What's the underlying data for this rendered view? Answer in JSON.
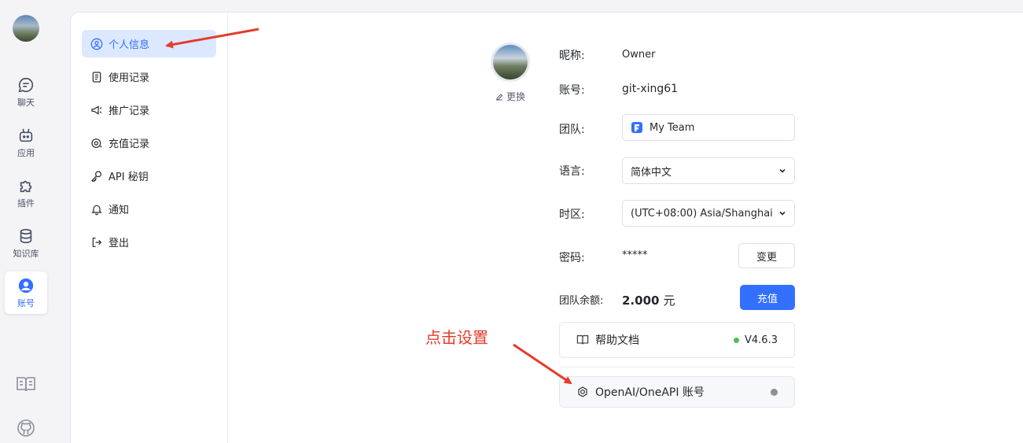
{
  "rail": {
    "items": [
      {
        "label": "聊天"
      },
      {
        "label": "应用"
      },
      {
        "label": "插件"
      },
      {
        "label": "知识库"
      },
      {
        "label": "账号"
      }
    ]
  },
  "sidebar": {
    "items": [
      {
        "label": "个人信息"
      },
      {
        "label": "使用记录"
      },
      {
        "label": "推广记录"
      },
      {
        "label": "充值记录"
      },
      {
        "label": "API 秘钥"
      },
      {
        "label": "通知"
      },
      {
        "label": "登出"
      }
    ]
  },
  "profile": {
    "change_avatar": "更换",
    "nickname_label": "昵称:",
    "nickname": "Owner",
    "account_label": "账号:",
    "account": "git-xing61",
    "team_label": "团队:",
    "team": "My Team",
    "language_label": "语言:",
    "language": "简体中文",
    "timezone_label": "时区:",
    "timezone": "(UTC+08:00) Asia/Shanghai",
    "password_label": "密码:",
    "password": "*****",
    "change_password": "变更",
    "balance_label": "团队余额:",
    "balance": "2.000",
    "balance_unit": "元",
    "recharge": "充值"
  },
  "help_docs": {
    "label": "帮助文档",
    "version": "V4.6.3",
    "status_color": "#4fbf4f"
  },
  "openai": {
    "label": "OpenAI/OneAPI 账号",
    "status_color": "#8a8f99"
  },
  "annotation": {
    "text": "点击设置",
    "color": "#e53b2c"
  },
  "colors": {
    "accent": "#3370ff",
    "active_bg": "#dbe8ff"
  }
}
